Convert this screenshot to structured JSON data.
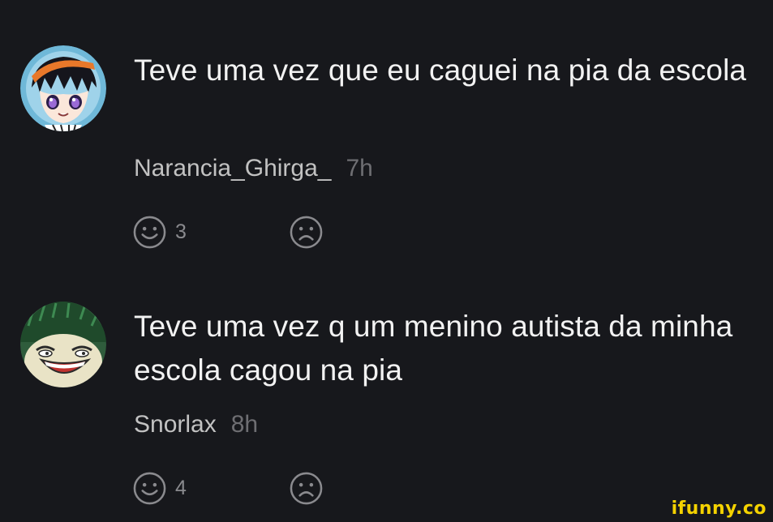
{
  "comments": [
    {
      "text": "Teve uma vez que eu caguei na pia da escola",
      "username": "Narancia_Ghirga_",
      "time": "7h",
      "smile_count": "3",
      "avatar_icon": "anime-boy-avatar"
    },
    {
      "text": "Teve uma vez q um menino autista da minha escola cagou na pia",
      "username": "Snorlax",
      "time": "8h",
      "smile_count": "4",
      "avatar_icon": "snorlax-trollface-avatar"
    }
  ],
  "icons": {
    "smile": "smile-icon",
    "frown": "frown-icon"
  },
  "colors": {
    "background": "#17181c",
    "text": "#f2f2f2",
    "username": "#c2c2c2",
    "time": "#6e6e72",
    "icon": "#8a8a8e",
    "watermark": "#f4d200"
  },
  "watermark": "ifunny.co"
}
